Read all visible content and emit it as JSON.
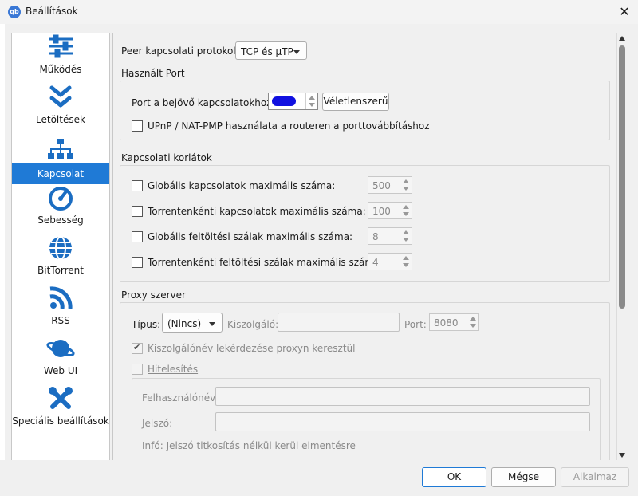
{
  "window": {
    "title": "Beállítások",
    "app_icon_text": "qb",
    "close_glyph": "✕"
  },
  "sidebar": {
    "items": [
      {
        "label": "Működés",
        "icon": "sliders-icon"
      },
      {
        "label": "Letöltések",
        "icon": "double-chevron-down-icon"
      },
      {
        "label": "Kapcsolat",
        "icon": "network-icon",
        "selected": true
      },
      {
        "label": "Sebesség",
        "icon": "speedometer-icon"
      },
      {
        "label": "BitTorrent",
        "icon": "globe-icon"
      },
      {
        "label": "RSS",
        "icon": "rss-icon"
      },
      {
        "label": "Web UI",
        "icon": "planet-icon"
      },
      {
        "label": "Speciális beállítások",
        "icon": "tools-icon"
      }
    ]
  },
  "protocol": {
    "label": "Peer kapcsolati protokoll:",
    "value": "TCP és µTP"
  },
  "port_group": {
    "title": "Használt Port",
    "incoming_label": "Port a bejövő kapcsolatokhoz:",
    "random_button": "Véletlenszerű",
    "upnp_label": "UPnP / NAT-PMP használata a routeren a porttovábbításhoz"
  },
  "limits_group": {
    "title": "Kapcsolati korlátok",
    "rows": [
      {
        "label": "Globális kapcsolatok maximális száma:",
        "value": "500"
      },
      {
        "label": "Torrentenkénti kapcsolatok maximális száma:",
        "value": "100"
      },
      {
        "label": "Globális feltöltési szálak maximális száma:",
        "value": "8"
      },
      {
        "label": "Torrentenkénti feltöltési szálak maximális száma:",
        "value": "4"
      }
    ]
  },
  "proxy_group": {
    "title": "Proxy szerver",
    "type_label": "Típus:",
    "type_value": "(Nincs)",
    "host_label": "Kiszolgáló:",
    "port_label": "Port:",
    "port_value": "8080",
    "hostname_lookup_label": "Kiszolgálónév lekérdezése proxyn keresztül",
    "auth_label": "Hitelesítés",
    "username_label": "Felhasználónév:",
    "password_label": "Jelszó:",
    "info_text": "Infó: Jelszó titkosítás nélkül kerül elmentésre"
  },
  "buttons": {
    "ok": "OK",
    "cancel": "Mégse",
    "apply": "Alkalmaz"
  },
  "colors": {
    "accent": "#1f7ad6",
    "icon_blue": "#1b6dc2",
    "redaction": "#1010e0"
  }
}
